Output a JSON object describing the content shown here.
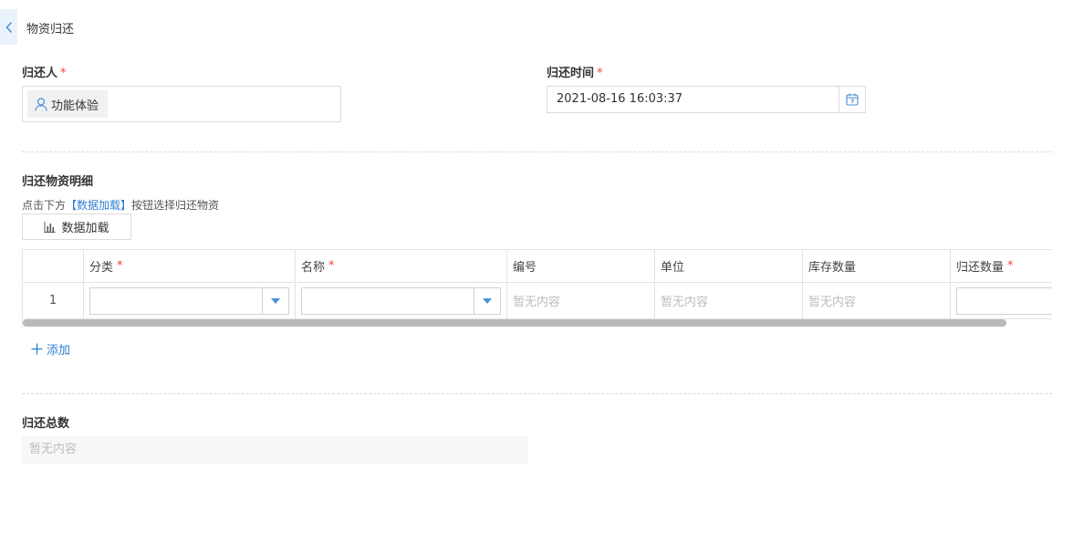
{
  "header": {
    "title": "物资归还"
  },
  "form": {
    "returner_label": "归还人",
    "returner_value": "功能体验",
    "return_time_label": "归还时间",
    "return_time_value": "2021-08-16 16:03:37",
    "required_mark": "*"
  },
  "details": {
    "section_title": "归还物资明细",
    "hint_prefix": "点击下方",
    "hint_link": "【数据加载】",
    "hint_suffix": "按钮选择归还物资",
    "load_button_label": "数据加载",
    "add_label": "添加",
    "columns": [
      {
        "label": "",
        "required": false
      },
      {
        "label": "分类",
        "required": true
      },
      {
        "label": "名称",
        "required": true
      },
      {
        "label": "编号",
        "required": false
      },
      {
        "label": "单位",
        "required": false
      },
      {
        "label": "库存数量",
        "required": false
      },
      {
        "label": "归还数量",
        "required": true
      }
    ],
    "rows": [
      {
        "index": "1",
        "category": "",
        "name": "",
        "code": "暂无内容",
        "unit": "暂无内容",
        "stock": "暂无内容",
        "return_qty": ""
      }
    ]
  },
  "total": {
    "label": "归还总数",
    "value": "暂无内容"
  },
  "icons": {
    "back": "chevron-left-icon",
    "user": "user-icon",
    "calendar": "calendar-icon",
    "chart": "bar-chart-icon",
    "dropdown": "caret-down-icon",
    "add": "plus-icon"
  },
  "colors": {
    "accent": "#2f7fd4",
    "required": "#f0483e",
    "placeholder": "#bdbdbd"
  }
}
